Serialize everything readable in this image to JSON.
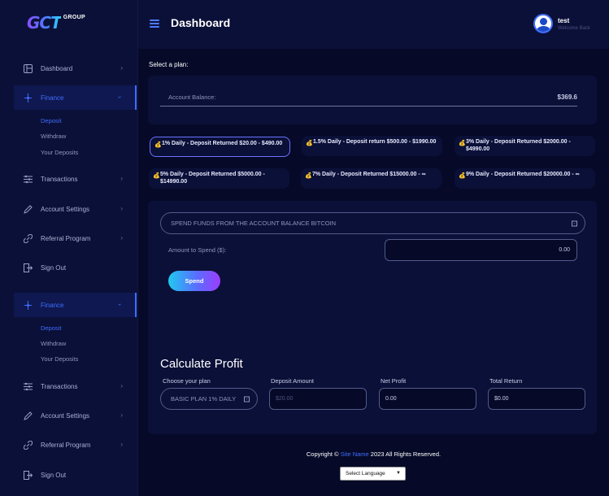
{
  "brand": {
    "logo_main": "GCT",
    "logo_sub": "GROUP"
  },
  "header": {
    "title": "Dashboard",
    "user_name": "test",
    "user_subtitle": "Welcome Back"
  },
  "sidebar": {
    "items": [
      {
        "label": "Dashboard",
        "icon": "dashboard-icon"
      },
      {
        "label": "Finance",
        "icon": "finance-icon"
      },
      {
        "label": "Transactions",
        "icon": "transactions-icon"
      },
      {
        "label": "Account Settings",
        "icon": "pencil-icon"
      },
      {
        "label": "Referral Program",
        "icon": "link-icon"
      },
      {
        "label": "Sign Out",
        "icon": "sign-out-icon"
      },
      {
        "label": "Finance",
        "icon": "finance-icon"
      },
      {
        "label": "Transactions",
        "icon": "transactions-icon"
      },
      {
        "label": "Account Settings",
        "icon": "pencil-icon"
      },
      {
        "label": "Referral Program",
        "icon": "link-icon"
      },
      {
        "label": "Sign Out",
        "icon": "sign-out-icon"
      }
    ],
    "finance_sub": [
      "Deposit",
      "Withdraw",
      "Your Deposits"
    ],
    "finance_sub_2": [
      "Deposit",
      "Withdraw",
      "Your Deposits"
    ]
  },
  "main": {
    "select_plan_label": "Select a plan:",
    "account_balance_label": "Account Balance:",
    "account_balance_value": "$369.6",
    "plans": [
      "1% Daily - Deposit Returned $20.00 - $490.00",
      "1.5% Daily - Deposit return $500.00 - $1990.00",
      "3% Daily - Deposit Returned $2000.00 - $4990.00",
      "5% Daily - Deposit Returned $5000.00 - $14990.00",
      "7% Daily - Deposit Returned $15000.00 - ∞",
      "9% Daily - Deposit Returned $20000.00 - ∞"
    ],
    "spend_source": "SPEND FUNDS FROM THE ACCOUNT BALANCE BITCOIN",
    "amount_label": "Amount to Spend ($):",
    "amount_value": "0.00",
    "spend_button": "Spend"
  },
  "calculator": {
    "title": "Calculate Profit",
    "choose_plan_label": "Choose your plan",
    "choose_plan_value": "BASIC PLAN 1% DAILY",
    "deposit_label": "Deposit Amount",
    "deposit_placeholder": "$20.00",
    "net_profit_label": "Net Profit",
    "net_profit_value": "0.00",
    "total_return_label": "Total Return",
    "total_return_value": "$0.00"
  },
  "footer": {
    "copyright_prefix": "Copyright ©",
    "site_name": "Site Name",
    "copyright_suffix": "2023 All Rights Reserved.",
    "language_select": "Select Language"
  },
  "colors": {
    "background": "#060a28",
    "panel": "#0b1038",
    "accent": "#3f6dff",
    "selected_border": "#6d72ff"
  }
}
